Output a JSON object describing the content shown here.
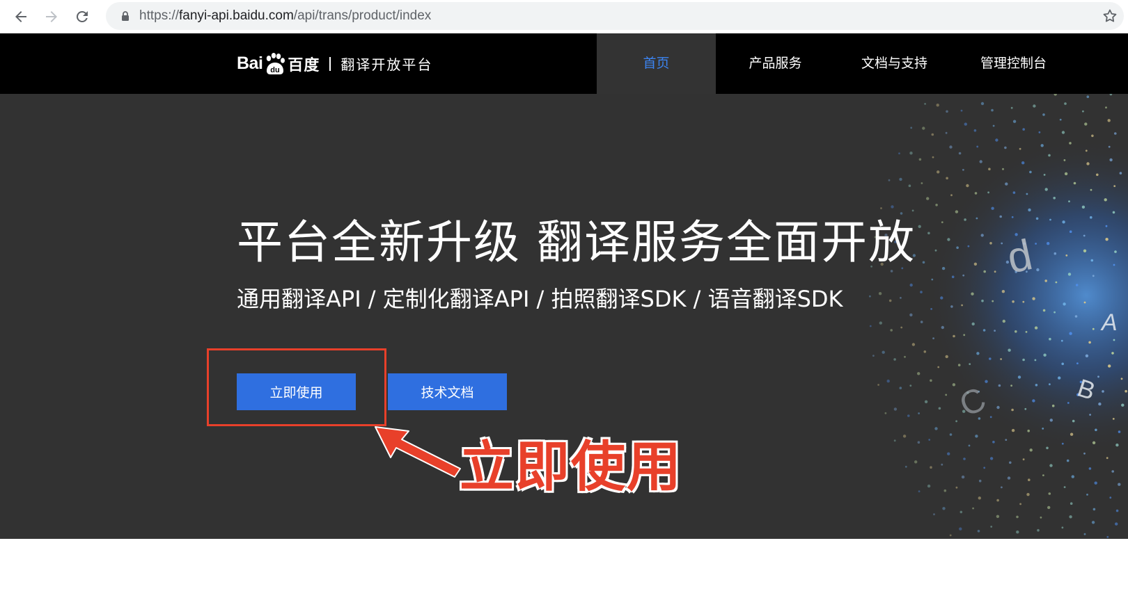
{
  "browser": {
    "url_scheme": "https://",
    "url_host": "fanyi-api.baidu.com",
    "url_path": "/api/trans/product/index"
  },
  "header": {
    "logo_text": "Bai",
    "logo_paw_text": "du",
    "logo_cn": "百度",
    "logo_subtitle": "翻译开放平台",
    "nav": [
      {
        "label": "首页",
        "active": true
      },
      {
        "label": "产品服务",
        "active": false
      },
      {
        "label": "文档与支持",
        "active": false
      },
      {
        "label": "管理控制台",
        "active": false
      }
    ],
    "active_color": "#3c84f0"
  },
  "hero": {
    "title": "平台全新升级 翻译服务全面开放",
    "subtitle": "通用翻译API / 定制化翻译API / 拍照翻译SDK / 语音翻译SDK",
    "primary_button": "立即使用",
    "secondary_button": "技术文档",
    "deco_letters": [
      "d",
      "A",
      "B",
      "C"
    ]
  },
  "annotation": {
    "callout": "立即使用",
    "color": "#e8402a"
  },
  "colors": {
    "header_bg": "#000000",
    "hero_bg": "#323232",
    "button_blue": "#2f6fe0"
  }
}
